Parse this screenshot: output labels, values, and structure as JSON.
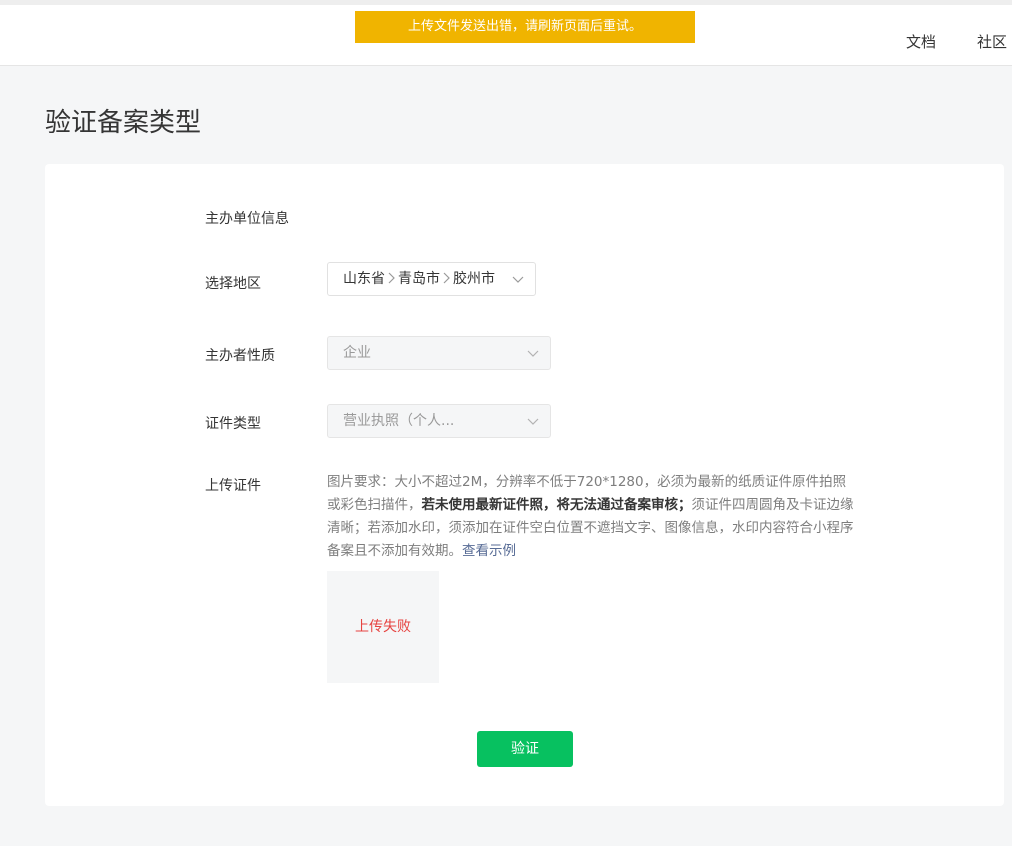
{
  "toast": {
    "message": "上传文件发送出错，请刷新页面后重试。",
    "color": "#f0b400"
  },
  "nav": {
    "docs": "文档",
    "community": "社区"
  },
  "page": {
    "title": "验证备案类型"
  },
  "form": {
    "section_title": "主办单位信息",
    "region": {
      "label": "选择地区",
      "province": "山东省",
      "city": "青岛市",
      "district": "胶州市",
      "separator_icon": "chevron-right-icon",
      "dropdown_icon": "chevron-down-icon"
    },
    "nature": {
      "label": "主办者性质",
      "value": "企业",
      "disabled": true
    },
    "cert_type": {
      "label": "证件类型",
      "value": "营业执照（个人...",
      "disabled": true
    },
    "upload": {
      "label": "上传证件",
      "desc_part1": "图片要求：大小不超过2M，分辨率不低于720*1280，必须为最新的纸质证件原件拍照或彩色扫描件，",
      "desc_strong": "若未使用最新证件照，将无法通过备案审核；",
      "desc_part2": "须证件四周圆角及卡证边缘清晰；若添加水印，须添加在证件空白位置不遮挡文字、图像信息，水印内容符合小程序备案且不添加有效期。",
      "example_link": "查看示例",
      "status": "上传失败",
      "status_color": "#e64340"
    },
    "submit_label": "验证",
    "submit_color": "#07c160"
  }
}
